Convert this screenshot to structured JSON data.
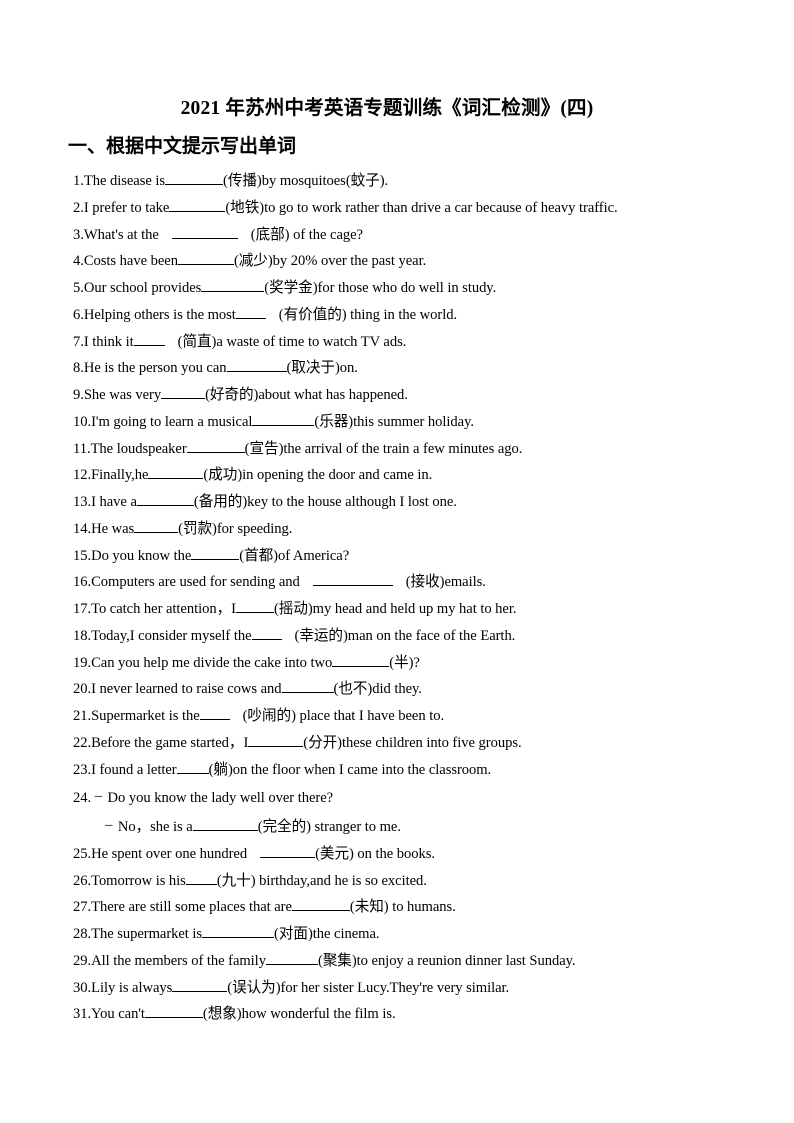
{
  "document": {
    "title": "2021 年苏州中考英语专题训练《词汇检测》(四)",
    "section_heading": "一、根据中文提示写出单词"
  },
  "questions": [
    {
      "number": "1.",
      "pre": "The disease is",
      "blank_width": 58,
      "post": "(传播)by  mosquitoes(蚊子).",
      "blank_gap_left": false,
      "blank_gap_right": false
    },
    {
      "number": "2.",
      "pre": "I prefer  to take",
      "blank_width": 56,
      "post": "(地铁)to  go to work rather  than  drive a car because of heavy traffic.",
      "blank_gap_left": false,
      "blank_gap_right": false
    },
    {
      "number": "3.",
      "pre": "What's at the",
      "blank_width": 66,
      "post": "(底部) of the cage?",
      "blank_gap_left": true,
      "blank_gap_right": true
    },
    {
      "number": "4.",
      "pre": "Costs have been",
      "blank_width": 56,
      "post": "(减少)by 20% over the past year.",
      "blank_gap_left": false,
      "blank_gap_right": false
    },
    {
      "number": "5.",
      "pre": "Our school provides",
      "blank_width": 63,
      "post": "(奖学金)for those who do well in study.",
      "blank_gap_left": false,
      "blank_gap_right": false
    },
    {
      "number": "6.",
      "pre": "Helping others is the most",
      "blank_width": 30,
      "post": "(有价值的) thing in the world.",
      "blank_gap_left": false,
      "blank_gap_right": true
    },
    {
      "number": "7.",
      "pre": "I think it",
      "blank_width": 31,
      "post": "(简直)a waste of time to watch TV ads.",
      "blank_gap_left": false,
      "blank_gap_right": true
    },
    {
      "number": "8.",
      "pre": "He is the person you can",
      "blank_width": 60,
      "post": "(取决于)on.",
      "blank_gap_left": false,
      "blank_gap_right": false
    },
    {
      "number": "9.",
      "pre": "She was very",
      "blank_width": 44,
      "post": "(好奇的)about what has happened.",
      "blank_gap_left": false,
      "blank_gap_right": false
    },
    {
      "number": "10.",
      "pre": "I'm going to learn a musical",
      "blank_width": 62,
      "post": "(乐器)this  summer holiday.",
      "blank_gap_left": false,
      "blank_gap_right": false
    },
    {
      "number": "11.",
      "pre": "The loudspeaker",
      "blank_width": 58,
      "post": "(宣告)the  arrival  of the train  a few minutes ago.",
      "blank_gap_left": false,
      "blank_gap_right": false
    },
    {
      "number": "12.",
      "pre": "Finally,he",
      "blank_width": 55,
      "post": "(成功)in  opening the door and came in.",
      "blank_gap_left": false,
      "blank_gap_right": false
    },
    {
      "number": "13.",
      "pre": "I have a",
      "blank_width": 57,
      "post": "(备用的)key to the house although I lost one.",
      "blank_gap_left": false,
      "blank_gap_right": false
    },
    {
      "number": "14.",
      "pre": "He was",
      "blank_width": 44,
      "post": "(罚款)for speeding.",
      "blank_gap_left": false,
      "blank_gap_right": false
    },
    {
      "number": "15.",
      "pre": "Do you know the",
      "blank_width": 48,
      "post": "(首都)of America?",
      "blank_gap_left": false,
      "blank_gap_right": false
    },
    {
      "number": "16.",
      "pre": "Computers are used for sending and",
      "blank_width": 80,
      "post": "(接收)emails.",
      "blank_gap_left": true,
      "blank_gap_right": true
    },
    {
      "number": "17.",
      "pre": "To catch her attention，I",
      "blank_width": 38,
      "post": "(摇动)my head and held up my hat to her.",
      "blank_gap_left": false,
      "blank_gap_right": false
    },
    {
      "number": "18.",
      "pre": "Today,I consider myself the",
      "blank_width": 30,
      "post": "(幸运的)man on the face of the Earth.",
      "blank_gap_left": false,
      "blank_gap_right": true
    },
    {
      "number": "19.",
      "pre": "Can you help me divide the cake into two",
      "blank_width": 57,
      "post": "(半)?",
      "blank_gap_left": false,
      "blank_gap_right": false
    },
    {
      "number": "20.",
      "pre": "I never learned to raise cows and",
      "blank_width": 52,
      "post": "(也不)did they.",
      "blank_gap_left": false,
      "blank_gap_right": false
    },
    {
      "number": "21.",
      "pre": "Supermarket is the",
      "blank_width": 30,
      "post": "(吵闹的) place that I have been to.",
      "blank_gap_left": false,
      "blank_gap_right": true
    },
    {
      "number": "22.",
      "pre": "Before the game started，I",
      "blank_width": 55,
      "post": "(分开)these  children into five groups.",
      "blank_gap_left": false,
      "blank_gap_right": false
    },
    {
      "number": "23.",
      "pre": "I found a letter",
      "blank_width": 32,
      "post": "(躺)on the floor when I came into the classroom.",
      "blank_gap_left": false,
      "blank_gap_right": false
    },
    {
      "number": "24.",
      "dash": "–",
      "pre": "Do you know the lady well over there?",
      "blank_width": 0,
      "post": "",
      "blank_gap_left": false,
      "blank_gap_right": false
    },
    {
      "number": "",
      "dash": "–",
      "indent": true,
      "pre": "No，she is a",
      "blank_width": 65,
      "post": "(完全的) stranger to me.",
      "blank_gap_left": false,
      "blank_gap_right": false
    },
    {
      "number": "25.",
      "pre": "He spent over one hundred",
      "blank_width": 55,
      "post": "(美元) on the books.",
      "blank_gap_left": true,
      "blank_gap_right": false
    },
    {
      "number": "26.",
      "pre": "Tomorrow is his",
      "blank_width": 31,
      "post": "(九十) birthday,and he is so excited.",
      "blank_gap_left": false,
      "blank_gap_right": false
    },
    {
      "number": "27.",
      "pre": "There are still  some places that are",
      "blank_width": 58,
      "post": "(未知) to humans.",
      "blank_gap_left": false,
      "blank_gap_right": false
    },
    {
      "number": "28.",
      "pre": "The supermarket is",
      "blank_width": 72,
      "post": "(对面)the  cinema.",
      "blank_gap_left": false,
      "blank_gap_right": false
    },
    {
      "number": "29.",
      "pre": "All the members of the family",
      "blank_width": 52,
      "post": "(聚集)to  enjoy a reunion dinner last Sunday.",
      "blank_gap_left": false,
      "blank_gap_right": false
    },
    {
      "number": "30.",
      "pre": "Lily is always",
      "blank_width": 55,
      "post": "(误认为)for her sister Lucy.They're very similar.",
      "blank_gap_left": false,
      "blank_gap_right": false
    },
    {
      "number": "31.",
      "pre": "You can't",
      "blank_width": 58,
      "post": "(想象)how wonderful the film is.",
      "blank_gap_left": false,
      "blank_gap_right": false
    }
  ]
}
